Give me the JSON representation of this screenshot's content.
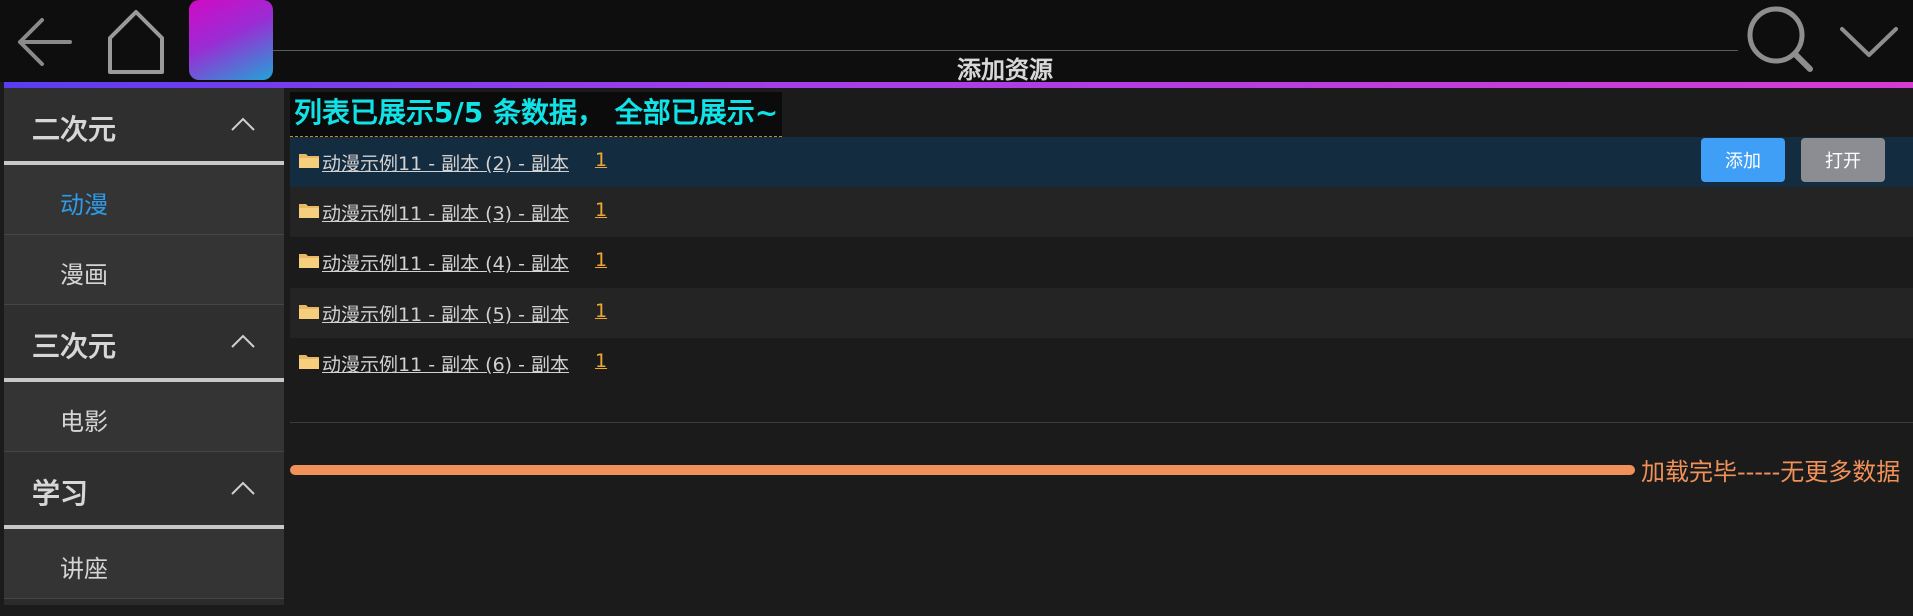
{
  "header": {
    "title": "添加资源",
    "back_icon": "back-arrow-icon",
    "home_icon": "home-icon",
    "search_icon": "search-icon",
    "dropdown_icon": "chevron-down-icon"
  },
  "colors": {
    "accent_gradient": [
      "#5a3df0",
      "#d63bd4"
    ],
    "summary_text": "#11e2e6",
    "active_item": "#2e9be8",
    "count_link": "#f0a830",
    "load_done": "#f0915a",
    "add_button": "#3f9ef6",
    "open_button": "#8c8d92"
  },
  "sidebar": {
    "categories": [
      {
        "label": "二次元",
        "expanded": true,
        "items": [
          {
            "label": "动漫",
            "active": true
          },
          {
            "label": "漫画",
            "active": false
          }
        ]
      },
      {
        "label": "三次元",
        "expanded": true,
        "items": [
          {
            "label": "电影",
            "active": false
          }
        ]
      },
      {
        "label": "学习",
        "expanded": true,
        "items": [
          {
            "label": "讲座",
            "active": false
          }
        ]
      }
    ]
  },
  "main": {
    "summary": "列表已展示5/5 条数据， 全部已展示~",
    "rows": [
      {
        "name": "动漫示例11 - 副本 (2) - 副本",
        "count": "1",
        "selected": true
      },
      {
        "name": "动漫示例11 - 副本 (3) - 副本",
        "count": "1",
        "selected": false
      },
      {
        "name": "动漫示例11 - 副本 (4) - 副本",
        "count": "1",
        "selected": false
      },
      {
        "name": "动漫示例11 - 副本 (5) - 副本",
        "count": "1",
        "selected": false
      },
      {
        "name": "动漫示例11 - 副本 (6) - 副本",
        "count": "1",
        "selected": false
      }
    ],
    "add_label": "添加",
    "open_label": "打开",
    "load_complete": "加载完毕-----无更多数据"
  }
}
